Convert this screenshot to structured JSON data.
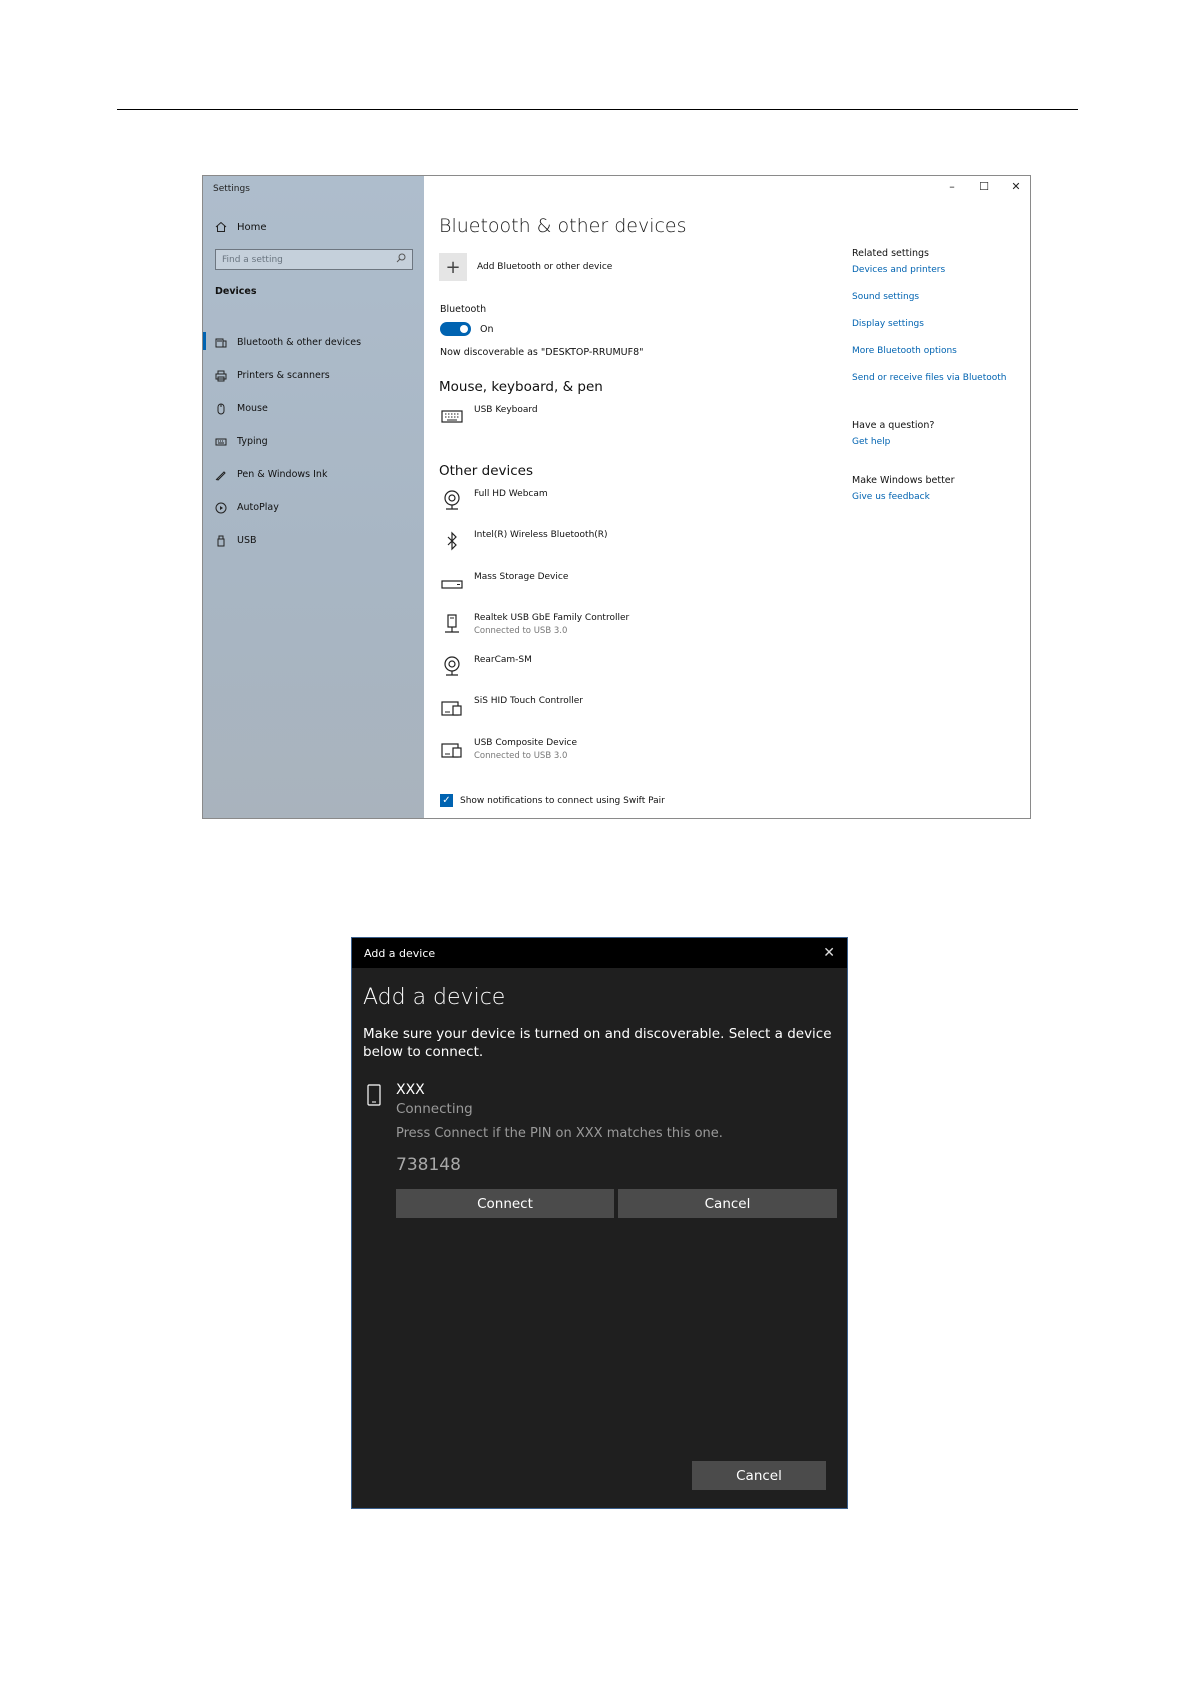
{
  "settings": {
    "window_title": "Settings",
    "controls": {
      "minimize": "–",
      "maximize": "☐",
      "close": "✕"
    },
    "sidebar": {
      "home": "Home",
      "search_placeholder": "Find a setting",
      "section": "Devices",
      "items": [
        {
          "label": "Bluetooth & other devices",
          "icon": "bluetooth-devices-icon",
          "active": true
        },
        {
          "label": "Printers & scanners",
          "icon": "printer-icon"
        },
        {
          "label": "Mouse",
          "icon": "mouse-icon"
        },
        {
          "label": "Typing",
          "icon": "keyboard-icon"
        },
        {
          "label": "Pen & Windows Ink",
          "icon": "pen-icon"
        },
        {
          "label": "AutoPlay",
          "icon": "autoplay-icon"
        },
        {
          "label": "USB",
          "icon": "usb-icon"
        }
      ]
    },
    "main": {
      "title": "Bluetooth & other devices",
      "add_device": "Add Bluetooth or other device",
      "bluetooth_label": "Bluetooth",
      "bluetooth_state": "On",
      "discoverable": "Now discoverable as \"DESKTOP-RRUMUF8\"",
      "mkp_heading": "Mouse, keyboard, & pen",
      "mkp_devices": [
        {
          "name": "USB Keyboard",
          "icon": "keyboard-icon"
        }
      ],
      "other_heading": "Other devices",
      "other_devices": [
        {
          "name": "Full HD Webcam",
          "sub": "",
          "icon": "webcam-icon"
        },
        {
          "name": "Intel(R) Wireless Bluetooth(R)",
          "sub": "",
          "icon": "bluetooth-icon"
        },
        {
          "name": "Mass Storage Device",
          "sub": "",
          "icon": "storage-icon"
        },
        {
          "name": "Realtek USB GbE Family Controller",
          "sub": "Connected to USB 3.0",
          "icon": "network-adapter-icon"
        },
        {
          "name": "RearCam-SM",
          "sub": "",
          "icon": "webcam-icon"
        },
        {
          "name": "SiS HID Touch Controller",
          "sub": "",
          "icon": "generic-device-icon"
        },
        {
          "name": "USB Composite Device",
          "sub": "Connected to USB 3.0",
          "icon": "generic-device-icon"
        }
      ],
      "swift_pair": "Show notifications to connect using Swift Pair"
    },
    "related": {
      "heading": "Related settings",
      "links": [
        "Devices and printers",
        "Sound settings",
        "Display settings",
        "More Bluetooth options",
        "Send or receive files via Bluetooth"
      ],
      "question_heading": "Have a question?",
      "help_link": "Get help",
      "better_heading": "Make Windows better",
      "feedback_link": "Give us feedback"
    }
  },
  "dialog": {
    "window_title": "Add a device",
    "close": "✕",
    "heading": "Add a device",
    "description": "Make sure your device is turned on and discoverable. Select a device below to connect.",
    "device_name": "XXX",
    "device_status": "Connecting",
    "pin_message": "Press Connect if the PIN on XXX matches this one.",
    "pin": "738148",
    "connect_label": "Connect",
    "cancel_label": "Cancel",
    "bottom_cancel_label": "Cancel"
  }
}
